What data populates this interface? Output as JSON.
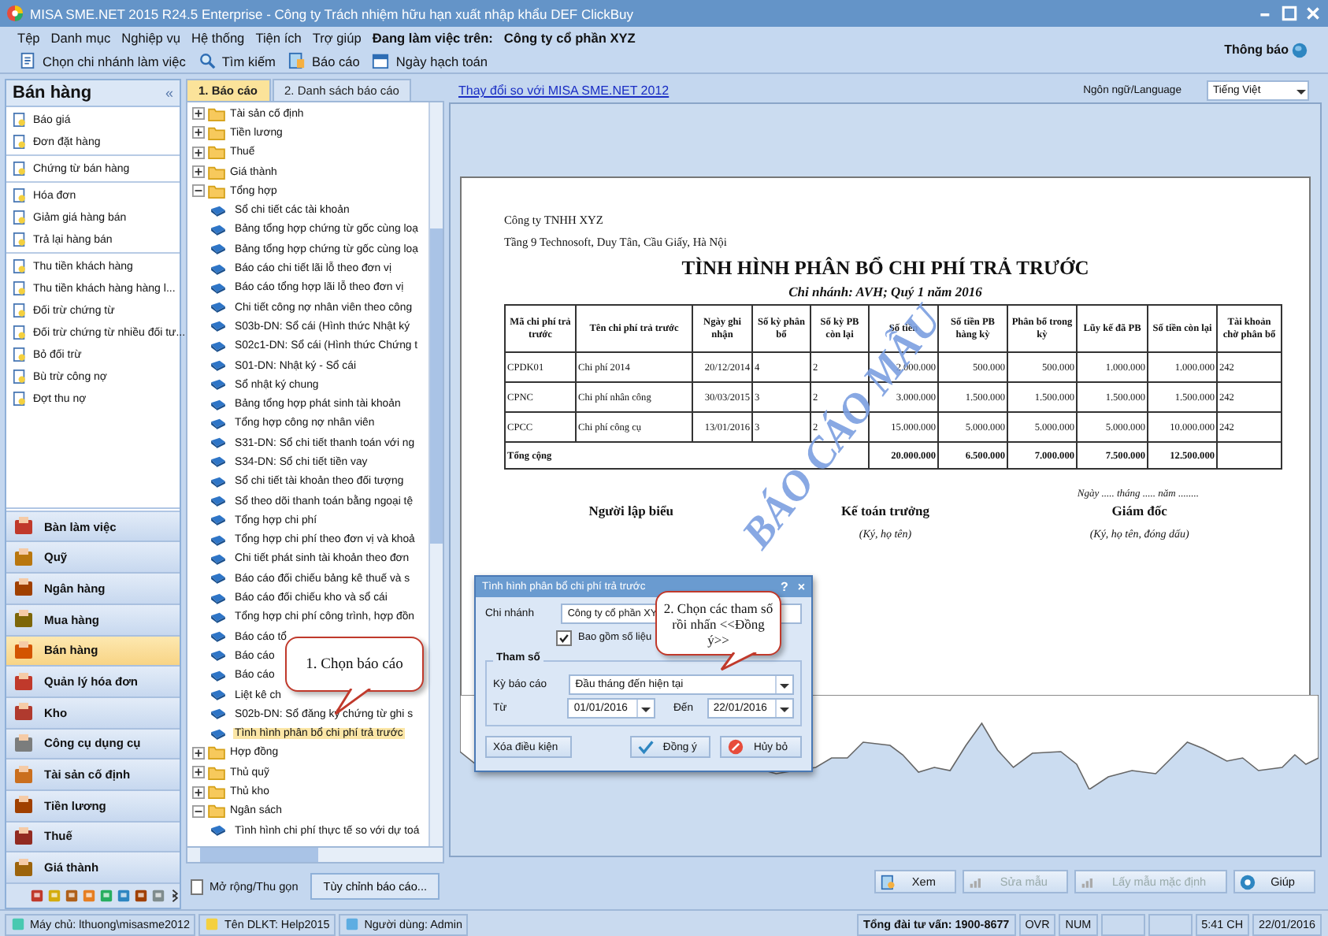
{
  "window": {
    "title": "MISA SME.NET 2015 R24.5 Enterprise - Công ty Trách nhiệm hữu hạn xuất nhập khẩu DEF ClickBuy"
  },
  "menu": [
    "Tệp",
    "Danh mục",
    "Nghiệp vụ",
    "Hệ thống",
    "Tiện ích",
    "Trợ giúp"
  ],
  "working_on": {
    "label": "Đang làm việc trên:",
    "value": "Công ty cổ phần XYZ"
  },
  "toolbar": [
    "Chọn chi nhánh làm việc",
    "Tìm kiếm",
    "Báo cáo",
    "Ngày hạch toán"
  ],
  "notification": "Thông báo",
  "sidebar": {
    "title": "Bán hàng",
    "collapse": "«",
    "groups": [
      {
        "items": [
          "Báo giá",
          "Đơn đặt hàng"
        ]
      },
      {
        "items": [
          "Chứng từ bán hàng"
        ]
      },
      {
        "items": [
          "Hóa đơn",
          "Giảm giá hàng bán",
          "Trả lại hàng bán"
        ]
      },
      {
        "items": [
          "Thu tiền khách hàng",
          "Thu tiền khách hàng hàng l...",
          "Đối trừ chứng từ",
          "Đối trừ chứng từ nhiều đối tư...",
          "Bỏ đối trừ",
          "Bù trừ công nợ",
          "Đợt thu nợ"
        ]
      }
    ]
  },
  "modules": [
    {
      "label": "Bàn làm việc",
      "selected": false
    },
    {
      "label": "Quỹ",
      "selected": false
    },
    {
      "label": "Ngân hàng",
      "selected": false
    },
    {
      "label": "Mua hàng",
      "selected": false
    },
    {
      "label": "Bán hàng",
      "selected": true
    },
    {
      "label": "Quản lý hóa đơn",
      "selected": false
    },
    {
      "label": "Kho",
      "selected": false
    },
    {
      "label": "Công cụ dụng cụ",
      "selected": false
    },
    {
      "label": "Tài sản cố định",
      "selected": false
    },
    {
      "label": "Tiền lương",
      "selected": false
    },
    {
      "label": "Thuế",
      "selected": false
    },
    {
      "label": "Giá thành",
      "selected": false
    }
  ],
  "tabs": [
    {
      "label": "1. Báo cáo",
      "selected": true
    },
    {
      "label": "2. Danh sách báo cáo",
      "selected": false
    }
  ],
  "tree": [
    {
      "label": "Tài sản cố định",
      "expanded": false
    },
    {
      "label": "Tiền lương",
      "expanded": false
    },
    {
      "label": "Thuế",
      "expanded": false
    },
    {
      "label": "Giá thành",
      "expanded": false
    },
    {
      "label": "Tổng hợp",
      "expanded": true,
      "children": [
        {
          "label": "Sổ chi tiết các tài khoản",
          "selected": false
        },
        {
          "label": "Bảng tổng hợp chứng từ gốc cùng loạ",
          "selected": false
        },
        {
          "label": "Bảng tổng hợp chứng từ gốc cùng loạ",
          "selected": false
        },
        {
          "label": "Báo cáo chi tiết lãi lỗ theo đơn vị",
          "selected": false
        },
        {
          "label": "Báo cáo tổng hợp lãi lỗ theo đơn vị",
          "selected": false
        },
        {
          "label": "Chi tiết công nợ nhân viên theo công",
          "selected": false
        },
        {
          "label": "S03b-DN: Sổ cái (Hình thức Nhật ký",
          "selected": false
        },
        {
          "label": "S02c1-DN: Sổ cái (Hình thức Chứng t",
          "selected": false
        },
        {
          "label": "S01-DN: Nhật ký - Sổ cái",
          "selected": false
        },
        {
          "label": "Sổ nhật ký chung",
          "selected": false
        },
        {
          "label": "Bảng tổng hợp phát sinh tài khoản",
          "selected": false
        },
        {
          "label": "Tổng hợp công nợ nhân viên",
          "selected": false
        },
        {
          "label": "S31-DN: Sổ chi tiết thanh toán với ng",
          "selected": false
        },
        {
          "label": "S34-DN: Sổ chi tiết tiền vay",
          "selected": false
        },
        {
          "label": "Sổ chi tiết tài khoản theo đối tượng",
          "selected": false
        },
        {
          "label": "Sổ theo dõi thanh toán bằng ngoại tệ",
          "selected": false
        },
        {
          "label": "Tổng hợp chi phí",
          "selected": false
        },
        {
          "label": "Tổng hợp chi phí theo đơn vị và khoả",
          "selected": false
        },
        {
          "label": "Chi tiết phát sinh tài khoản theo đơn",
          "selected": false
        },
        {
          "label": "Báo cáo đối chiếu bảng kê thuế và s",
          "selected": false
        },
        {
          "label": "Báo cáo đối chiếu kho và sổ cái",
          "selected": false
        },
        {
          "label": "Tổng hợp chi phí công trình, hợp đồn",
          "selected": false
        },
        {
          "label": "Báo cáo tổ",
          "selected": false
        },
        {
          "label": "Báo cáo",
          "selected": false
        },
        {
          "label": "Báo cáo",
          "selected": false
        },
        {
          "label": "Liệt kê ch",
          "selected": false
        },
        {
          "label": "S02b-DN: Sổ đăng ký chứng từ ghi s",
          "selected": false
        },
        {
          "label": "Tình hình phân bổ chi phí trả trước",
          "selected": true
        }
      ]
    },
    {
      "label": "Hợp đồng",
      "expanded": false
    },
    {
      "label": "Thủ quỹ",
      "expanded": false
    },
    {
      "label": "Thủ kho",
      "expanded": false
    },
    {
      "label": "Ngân sách",
      "expanded": true,
      "children": [
        {
          "label": "Tình hình chi phí thực tế so với dự toá",
          "selected": false
        }
      ]
    }
  ],
  "expand_toggle": {
    "label": "Mở rộng/Thu gọn",
    "checked": false
  },
  "customize_button": "Tùy chỉnh báo cáo...",
  "link": "Thay đổi so với MISA SME.NET 2012",
  "language": {
    "label": "Ngôn ngữ/Language",
    "value": "Tiếng Việt"
  },
  "report": {
    "company": "Công ty TNHH XYZ",
    "address": "Tầng 9 Technosoft, Duy Tân, Cầu Giấy, Hà Nội",
    "title": "TÌNH HÌNH PHÂN BỔ CHI PHÍ TRẢ TRƯỚC",
    "subtitle": "Chi nhánh: AVH; Quý 1 năm 2016",
    "columns": [
      "Mã chi phí trả trước",
      "Tên chi phí trả trước",
      "Ngày ghi nhận",
      "Số kỳ phân bổ",
      "Số kỳ PB còn lại",
      "Số tiền",
      "Số tiền PB hàng kỳ",
      "Phân bổ trong kỳ",
      "Lũy kế đã PB",
      "Số tiền còn lại",
      "Tài khoản chờ phân bổ"
    ],
    "rows": [
      [
        "CPDK01",
        "Chi phí 2014",
        "20/12/2014",
        "4",
        "2",
        "2.000.000",
        "500.000",
        "500.000",
        "1.000.000",
        "1.000.000",
        "242"
      ],
      [
        "CPNC",
        "Chi phí nhân công",
        "30/03/2015",
        "3",
        "2",
        "3.000.000",
        "1.500.000",
        "1.500.000",
        "1.500.000",
        "1.500.000",
        "242"
      ],
      [
        "CPCC",
        "Chi phí công cụ",
        "13/01/2016",
        "3",
        "2",
        "15.000.000",
        "5.000.000",
        "5.000.000",
        "5.000.000",
        "10.000.000",
        "242"
      ]
    ],
    "total": {
      "label": "Tổng cộng",
      "cells": [
        "20.000.000",
        "6.500.000",
        "7.000.000",
        "7.500.000",
        "12.500.000"
      ]
    },
    "date_line": "Ngày ..... tháng ..... năm ........",
    "signatures": [
      {
        "role": "Người lập biểu"
      },
      {
        "role": "Kế toán trưởng",
        "note": "(Ký, họ tên)"
      },
      {
        "role": "Giám đốc",
        "note": "(Ký, họ tên, đóng dấu)"
      }
    ],
    "watermark": "BÁO CÁO MẪU"
  },
  "report_buttons": [
    {
      "label": "Xem",
      "disabled": false
    },
    {
      "label": "Sửa mẫu",
      "disabled": true
    },
    {
      "label": "Lấy mẫu mặc định",
      "disabled": true
    },
    {
      "label": "Giúp",
      "disabled": false
    }
  ],
  "dialog": {
    "title": "Tình hình phân bổ chi phí trả trước",
    "help": "?",
    "close": "×",
    "branch": {
      "label": "Chi nhánh",
      "value": "Công ty cổ phần XY"
    },
    "include": {
      "label": "Bao gồm số liệu",
      "checked": true
    },
    "group": "Tham số",
    "period": {
      "label": "Kỳ báo cáo",
      "value": "Đầu tháng đến hiện tại"
    },
    "from": {
      "label": "Từ",
      "value": "01/01/2016"
    },
    "to": {
      "label": "Đến",
      "value": "22/01/2016"
    },
    "clear": "Xóa điều kiện",
    "ok": "Đồng ý",
    "cancel": "Hủy bỏ"
  },
  "callouts": [
    "1. Chọn báo cáo",
    "2. Chọn các tham số rồi nhấn <<Đồng ý>>"
  ],
  "status_bar": {
    "left": [
      "Máy chủ: lthuong\\misasme2012",
      "Tên DLKT: Help2015",
      "Người dùng: Admin"
    ],
    "hotline": "Tổng đài tư vấn: 1900-8677",
    "right": [
      "OVR",
      "NUM",
      "5:41 CH",
      "22/01/2016"
    ]
  }
}
